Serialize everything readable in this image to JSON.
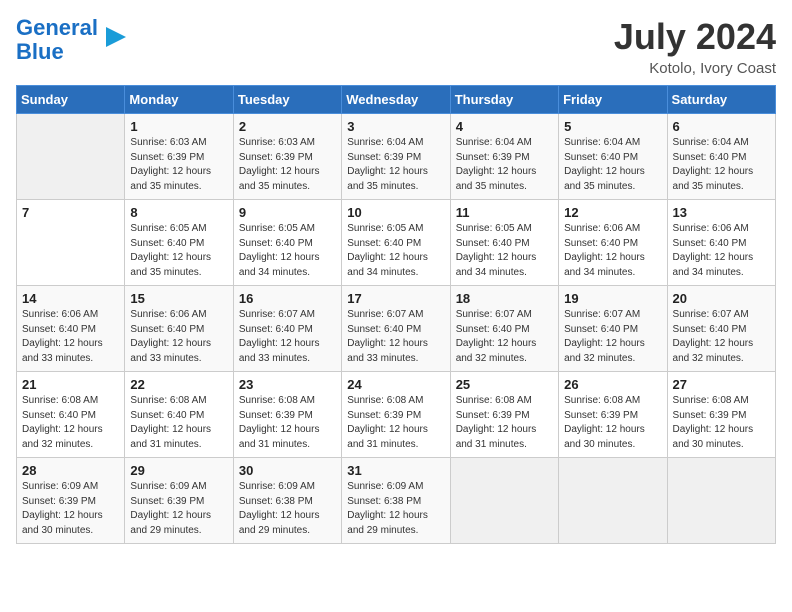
{
  "logo": {
    "line1": "General",
    "line2": "Blue"
  },
  "title": "July 2024",
  "subtitle": "Kotolo, Ivory Coast",
  "days_header": [
    "Sunday",
    "Monday",
    "Tuesday",
    "Wednesday",
    "Thursday",
    "Friday",
    "Saturday"
  ],
  "weeks": [
    [
      {
        "day": "",
        "info": ""
      },
      {
        "day": "1",
        "info": "Sunrise: 6:03 AM\nSunset: 6:39 PM\nDaylight: 12 hours\nand 35 minutes."
      },
      {
        "day": "2",
        "info": "Sunrise: 6:03 AM\nSunset: 6:39 PM\nDaylight: 12 hours\nand 35 minutes."
      },
      {
        "day": "3",
        "info": "Sunrise: 6:04 AM\nSunset: 6:39 PM\nDaylight: 12 hours\nand 35 minutes."
      },
      {
        "day": "4",
        "info": "Sunrise: 6:04 AM\nSunset: 6:39 PM\nDaylight: 12 hours\nand 35 minutes."
      },
      {
        "day": "5",
        "info": "Sunrise: 6:04 AM\nSunset: 6:40 PM\nDaylight: 12 hours\nand 35 minutes."
      },
      {
        "day": "6",
        "info": "Sunrise: 6:04 AM\nSunset: 6:40 PM\nDaylight: 12 hours\nand 35 minutes."
      }
    ],
    [
      {
        "day": "7",
        "info": ""
      },
      {
        "day": "8",
        "info": "Sunrise: 6:05 AM\nSunset: 6:40 PM\nDaylight: 12 hours\nand 35 minutes."
      },
      {
        "day": "9",
        "info": "Sunrise: 6:05 AM\nSunset: 6:40 PM\nDaylight: 12 hours\nand 34 minutes."
      },
      {
        "day": "10",
        "info": "Sunrise: 6:05 AM\nSunset: 6:40 PM\nDaylight: 12 hours\nand 34 minutes."
      },
      {
        "day": "11",
        "info": "Sunrise: 6:05 AM\nSunset: 6:40 PM\nDaylight: 12 hours\nand 34 minutes."
      },
      {
        "day": "12",
        "info": "Sunrise: 6:06 AM\nSunset: 6:40 PM\nDaylight: 12 hours\nand 34 minutes."
      },
      {
        "day": "13",
        "info": "Sunrise: 6:06 AM\nSunset: 6:40 PM\nDaylight: 12 hours\nand 34 minutes."
      }
    ],
    [
      {
        "day": "14",
        "info": "Sunrise: 6:06 AM\nSunset: 6:40 PM\nDaylight: 12 hours\nand 33 minutes."
      },
      {
        "day": "15",
        "info": "Sunrise: 6:06 AM\nSunset: 6:40 PM\nDaylight: 12 hours\nand 33 minutes."
      },
      {
        "day": "16",
        "info": "Sunrise: 6:07 AM\nSunset: 6:40 PM\nDaylight: 12 hours\nand 33 minutes."
      },
      {
        "day": "17",
        "info": "Sunrise: 6:07 AM\nSunset: 6:40 PM\nDaylight: 12 hours\nand 33 minutes."
      },
      {
        "day": "18",
        "info": "Sunrise: 6:07 AM\nSunset: 6:40 PM\nDaylight: 12 hours\nand 32 minutes."
      },
      {
        "day": "19",
        "info": "Sunrise: 6:07 AM\nSunset: 6:40 PM\nDaylight: 12 hours\nand 32 minutes."
      },
      {
        "day": "20",
        "info": "Sunrise: 6:07 AM\nSunset: 6:40 PM\nDaylight: 12 hours\nand 32 minutes."
      }
    ],
    [
      {
        "day": "21",
        "info": "Sunrise: 6:08 AM\nSunset: 6:40 PM\nDaylight: 12 hours\nand 32 minutes."
      },
      {
        "day": "22",
        "info": "Sunrise: 6:08 AM\nSunset: 6:40 PM\nDaylight: 12 hours\nand 31 minutes."
      },
      {
        "day": "23",
        "info": "Sunrise: 6:08 AM\nSunset: 6:39 PM\nDaylight: 12 hours\nand 31 minutes."
      },
      {
        "day": "24",
        "info": "Sunrise: 6:08 AM\nSunset: 6:39 PM\nDaylight: 12 hours\nand 31 minutes."
      },
      {
        "day": "25",
        "info": "Sunrise: 6:08 AM\nSunset: 6:39 PM\nDaylight: 12 hours\nand 31 minutes."
      },
      {
        "day": "26",
        "info": "Sunrise: 6:08 AM\nSunset: 6:39 PM\nDaylight: 12 hours\nand 30 minutes."
      },
      {
        "day": "27",
        "info": "Sunrise: 6:08 AM\nSunset: 6:39 PM\nDaylight: 12 hours\nand 30 minutes."
      }
    ],
    [
      {
        "day": "28",
        "info": "Sunrise: 6:09 AM\nSunset: 6:39 PM\nDaylight: 12 hours\nand 30 minutes."
      },
      {
        "day": "29",
        "info": "Sunrise: 6:09 AM\nSunset: 6:39 PM\nDaylight: 12 hours\nand 29 minutes."
      },
      {
        "day": "30",
        "info": "Sunrise: 6:09 AM\nSunset: 6:38 PM\nDaylight: 12 hours\nand 29 minutes."
      },
      {
        "day": "31",
        "info": "Sunrise: 6:09 AM\nSunset: 6:38 PM\nDaylight: 12 hours\nand 29 minutes."
      },
      {
        "day": "",
        "info": ""
      },
      {
        "day": "",
        "info": ""
      },
      {
        "day": "",
        "info": ""
      }
    ]
  ]
}
